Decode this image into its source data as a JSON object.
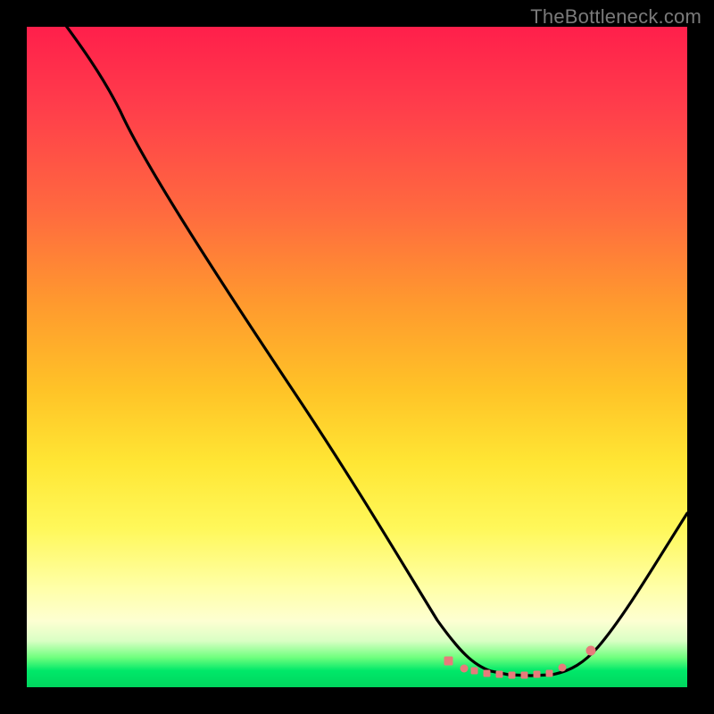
{
  "watermark": "TheBottleneck.com",
  "chart_data": {
    "type": "line",
    "title": "",
    "xlabel": "",
    "ylabel": "",
    "xlim": [
      0,
      100
    ],
    "ylim": [
      0,
      100
    ],
    "grid": false,
    "legend": false,
    "background_gradient": {
      "direction": "vertical",
      "stops": [
        {
          "pos": 0,
          "color": "#ff1f4b",
          "meaning": "high bottleneck"
        },
        {
          "pos": 50,
          "color": "#ffc327",
          "meaning": "moderate"
        },
        {
          "pos": 88,
          "color": "#ffffcf",
          "meaning": "low"
        },
        {
          "pos": 100,
          "color": "#00d65e",
          "meaning": "optimal"
        }
      ]
    },
    "series": [
      {
        "name": "bottleneck-curve",
        "color": "#000000",
        "x": [
          0,
          5,
          10,
          14,
          20,
          30,
          40,
          50,
          57,
          62,
          66,
          70,
          74,
          78,
          82,
          85,
          90,
          95,
          100
        ],
        "values": [
          103,
          98,
          91,
          86,
          77,
          63,
          49,
          35,
          25,
          16,
          10,
          6,
          3,
          2,
          2,
          4,
          10,
          18,
          27
        ]
      },
      {
        "name": "optimal-markers",
        "type": "scatter",
        "color": "#e77b7b",
        "x": [
          64,
          67,
          70,
          72,
          74,
          76,
          78,
          80,
          82,
          85
        ],
        "values": [
          6,
          4,
          3,
          2,
          2,
          2,
          2,
          2,
          3,
          5
        ]
      }
    ]
  }
}
